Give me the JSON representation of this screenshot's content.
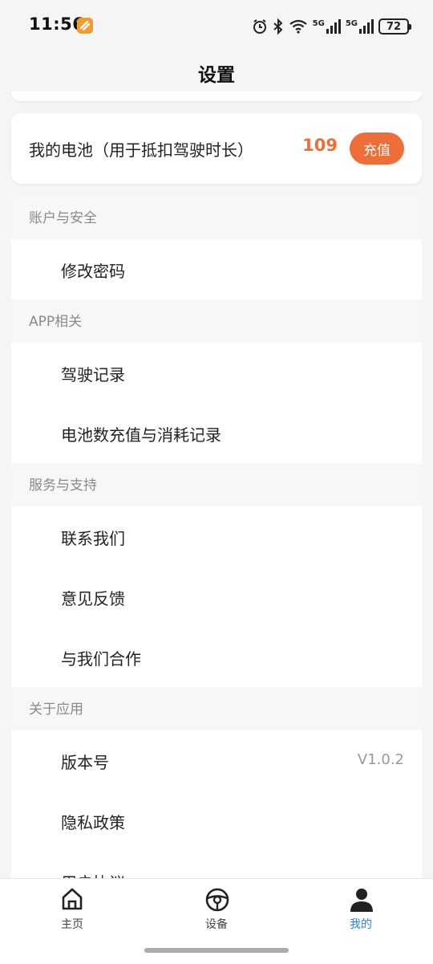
{
  "status_bar": {
    "time": "11:56",
    "network_5g_a": "5G",
    "network_5g_b": "5G",
    "battery": "72"
  },
  "header": {
    "title": "设置"
  },
  "battery_card": {
    "label": "我的电池（用于抵扣驾驶时长）",
    "count": "109",
    "recharge_label": "充值"
  },
  "sections": [
    {
      "title": "账户与安全",
      "items": [
        {
          "label": "修改密码"
        }
      ]
    },
    {
      "title": "APP相关",
      "items": [
        {
          "label": "驾驶记录"
        },
        {
          "label": "电池数充值与消耗记录"
        }
      ]
    },
    {
      "title": "服务与支持",
      "items": [
        {
          "label": "联系我们"
        },
        {
          "label": "意见反馈"
        },
        {
          "label": "与我们合作"
        }
      ]
    },
    {
      "title": "关于应用",
      "items": [
        {
          "label": "版本号",
          "value": "V1.0.2"
        },
        {
          "label": "隐私政策"
        },
        {
          "label": "用户协议"
        }
      ]
    }
  ],
  "tabs": [
    {
      "label": "主页",
      "icon": "home-icon"
    },
    {
      "label": "设备",
      "icon": "steering-wheel-icon"
    },
    {
      "label": "我的",
      "icon": "user-icon",
      "active": true
    }
  ],
  "colors": {
    "accent": "#ee6e3a",
    "active_tab": "#3a7be0"
  }
}
